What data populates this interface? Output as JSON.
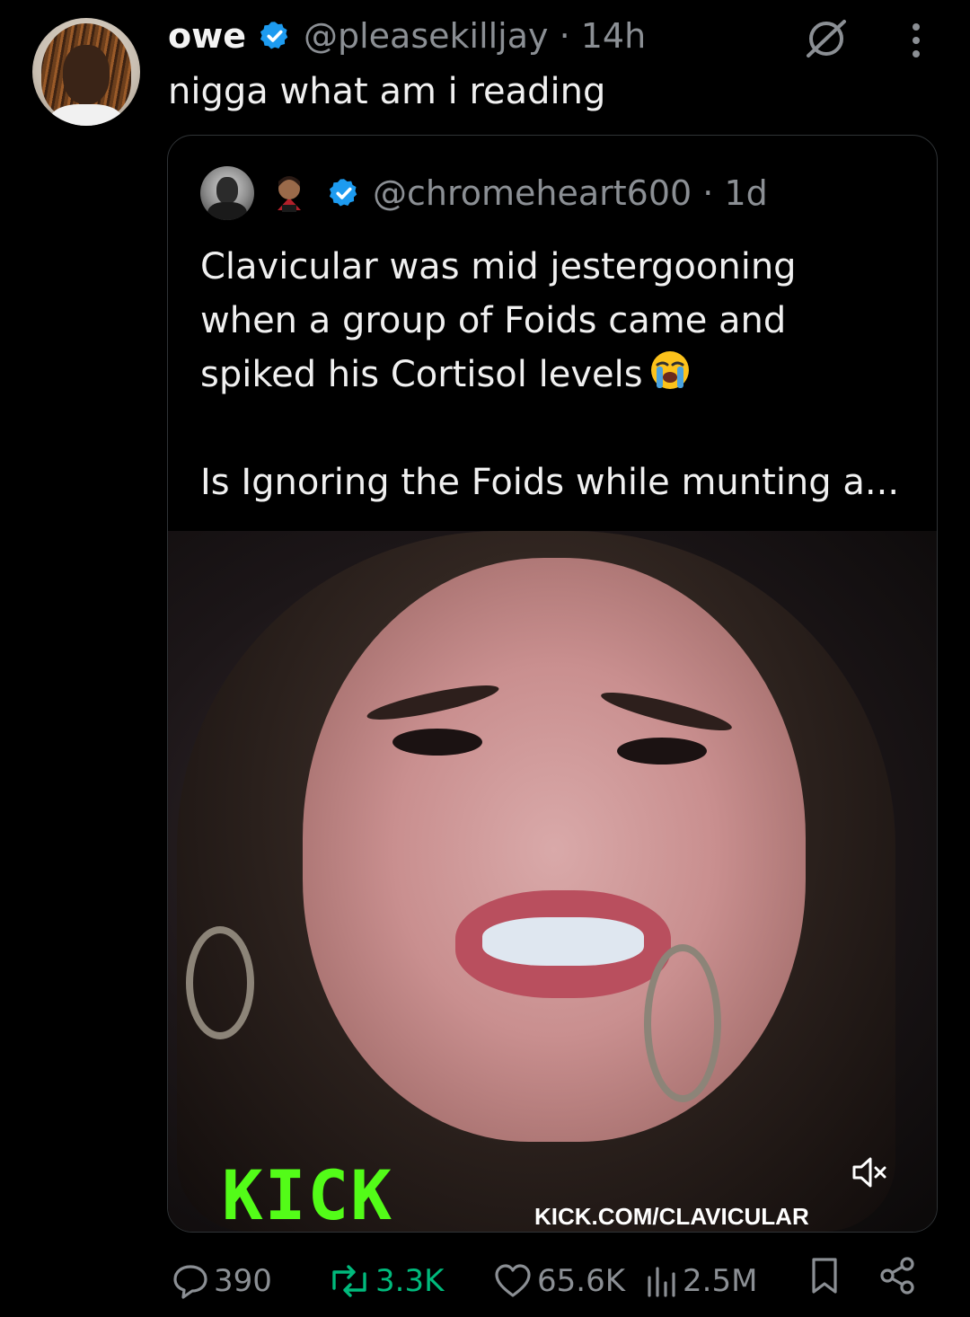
{
  "tweet": {
    "author_name": "owe",
    "handle_time": "@pleasekilljay · 14h",
    "text": "nigga what am i reading"
  },
  "quoted": {
    "handle_time": "@chromeheart600 · 1d",
    "lines": [
      "Clavicular was mid jestergooning",
      "when a group of Foids came and",
      "spiked his Cortisol levels"
    ],
    "line_more": "Is Ignoring the Foids while munting a...",
    "video": {
      "logo_text": "KICK",
      "url_text": "KICK.COM/CLAVICULAR",
      "mute_icon": "speaker-muted-icon"
    }
  },
  "actions": {
    "replies": "390",
    "retweets": "3.3K",
    "likes": "65.6K",
    "views": "2.5M"
  },
  "colors": {
    "verified": "#1d9bf0",
    "retweet": "#00ba7c",
    "kick_green": "#53fc18",
    "muted_text": "#8b8f94"
  },
  "icons": {
    "verified": "verified-badge-icon",
    "grok": "grok-icon",
    "more": "more-vertical-icon",
    "reply": "reply-icon",
    "retweet": "retweet-icon",
    "like": "heart-icon",
    "views": "views-icon",
    "bookmark": "bookmark-icon",
    "share": "share-icon"
  }
}
